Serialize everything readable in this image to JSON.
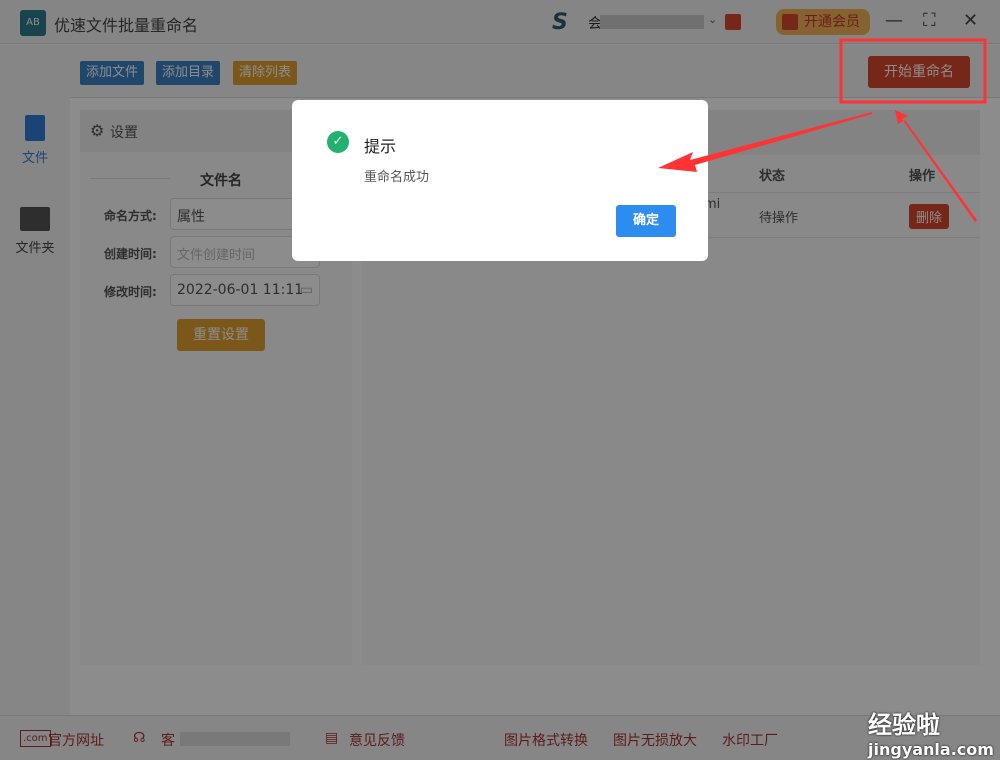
{
  "titlebar": {
    "app_title": "优速文件批量重命名",
    "logo_text": "AB",
    "user_prefix": "会",
    "vip_button": "开通会员",
    "minimize": "—",
    "maximize": "⛶",
    "close": "✕"
  },
  "sidebar": {
    "items": [
      {
        "label": "文件",
        "icon": "file-icon"
      },
      {
        "label": "文件夹",
        "icon": "folder-icon"
      }
    ]
  },
  "toolbar": {
    "add_file": "添加文件",
    "add_dir": "添加目录",
    "clear_list": "清除列表",
    "start_rename": "开始重命名"
  },
  "settings": {
    "title": "设置",
    "section": "文件名",
    "fields": [
      {
        "label": "命名方式:",
        "value": "属性"
      },
      {
        "label": "创建时间:",
        "placeholder": "文件创建时间"
      },
      {
        "label": "修改时间:",
        "value": "2022-06-01 11:11"
      }
    ],
    "reset": "重置设置"
  },
  "list": {
    "columns": [
      "状态",
      "操作"
    ],
    "rows": [
      {
        "name_fragment": "mi",
        "status": "待操作",
        "action": "删除"
      }
    ]
  },
  "footer": {
    "links": [
      "官方网址",
      "客",
      "意见反馈",
      "图片格式转换",
      "图片无损放大",
      "水印工厂"
    ]
  },
  "dialog": {
    "title": "提示",
    "message": "重命名成功",
    "confirm": "确定"
  },
  "watermark": {
    "line1": "经验啦",
    "line2": "jingyanla.com"
  },
  "colors": {
    "blue": "#3b82c4",
    "orange": "#e0a030",
    "red": "#d9472b",
    "annotation": "#ff3333",
    "confirm": "#2d8cf0",
    "success": "#23b26d"
  }
}
